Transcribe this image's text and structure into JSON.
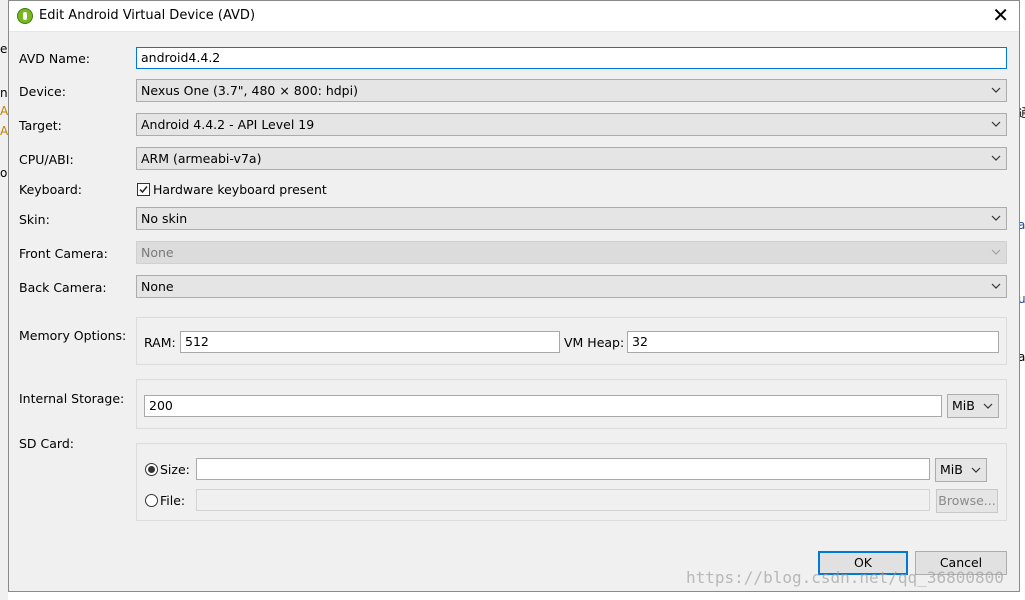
{
  "dialog": {
    "title": "Edit Android Virtual Device (AVD)",
    "close_label": "✕"
  },
  "fields": {
    "avd_name": {
      "label": "AVD Name:",
      "value": "android4.4.2"
    },
    "device": {
      "label": "Device:",
      "value": "Nexus One (3.7\", 480 × 800: hdpi)"
    },
    "target": {
      "label": "Target:",
      "value": "Android 4.4.2 - API Level 19"
    },
    "cpu_abi": {
      "label": "CPU/ABI:",
      "value": "ARM (armeabi-v7a)"
    },
    "keyboard": {
      "label": "Keyboard:",
      "checkbox_label": "Hardware keyboard present",
      "checked": true
    },
    "skin": {
      "label": "Skin:",
      "value": "No skin"
    },
    "front_camera": {
      "label": "Front Camera:",
      "value": "None"
    },
    "back_camera": {
      "label": "Back Camera:",
      "value": "None"
    },
    "memory": {
      "label": "Memory Options:",
      "ram_label": "RAM:",
      "ram_value": "512",
      "vmheap_label": "VM Heap:",
      "vmheap_value": "32"
    },
    "internal_storage": {
      "label": "Internal Storage:",
      "value": "200",
      "unit": "MiB"
    },
    "sd_card": {
      "label": "SD Card:",
      "size_label": "Size:",
      "size_value": "",
      "size_unit": "MiB",
      "file_label": "File:",
      "file_value": "",
      "browse_label": "Browse...",
      "selected": "size"
    }
  },
  "buttons": {
    "ok": "OK",
    "cancel": "Cancel"
  },
  "watermark": "https://blog.csdn.net/qq_36800800",
  "colors": {
    "accent": "#0078d7",
    "dialog_bg": "#f0f0f0",
    "icon_green": "#78b91f"
  }
}
